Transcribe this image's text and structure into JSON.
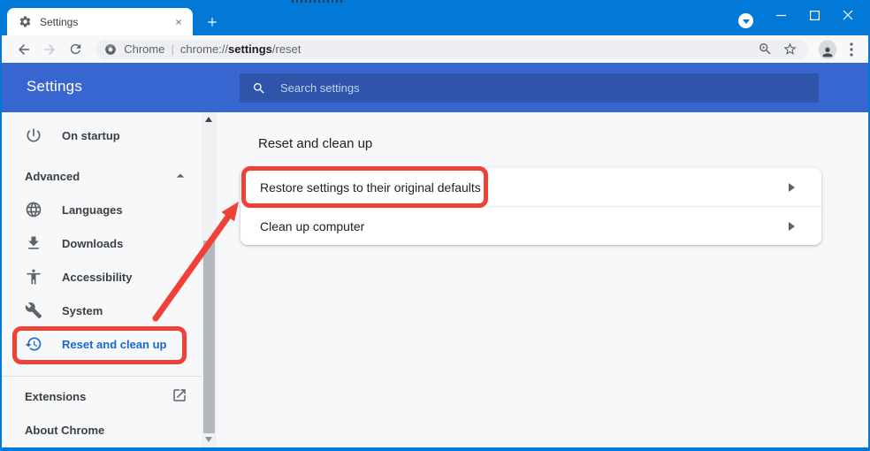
{
  "tab_strip": {
    "tab_title": "Settings"
  },
  "toolbar": {
    "omnibox": {
      "site_label": "Chrome",
      "separator": "|",
      "url_scheme": "chrome://",
      "url_host": "settings",
      "url_rest": "/reset"
    }
  },
  "header": {
    "title": "Settings",
    "search_placeholder": "Search settings"
  },
  "sidebar": {
    "items": [
      {
        "label": "On startup",
        "icon": "power-icon"
      },
      {
        "label": "Advanced",
        "trailing_icon": "chevron-up-icon"
      },
      {
        "label": "Languages",
        "icon": "globe-icon"
      },
      {
        "label": "Downloads",
        "icon": "download-icon"
      },
      {
        "label": "Accessibility",
        "icon": "accessibility-icon"
      },
      {
        "label": "System",
        "icon": "wrench-icon"
      },
      {
        "label": "Reset and clean up",
        "icon": "history-icon",
        "selected": true,
        "highlighted": true
      }
    ],
    "footer": [
      {
        "label": "Extensions",
        "trailing_icon": "open-in-new-icon"
      },
      {
        "label": "About Chrome"
      }
    ]
  },
  "main": {
    "section_title": "Reset and clean up",
    "rows": [
      {
        "label": "Restore settings to their original defaults",
        "highlighted": true
      },
      {
        "label": "Clean up computer"
      }
    ]
  },
  "colors": {
    "titlebar_blue": "#0278d7",
    "header_blue": "#3866d0",
    "search_box_blue": "#2e55a9",
    "annotation_red": "#f04136",
    "selected_link_blue": "#1967d2"
  }
}
